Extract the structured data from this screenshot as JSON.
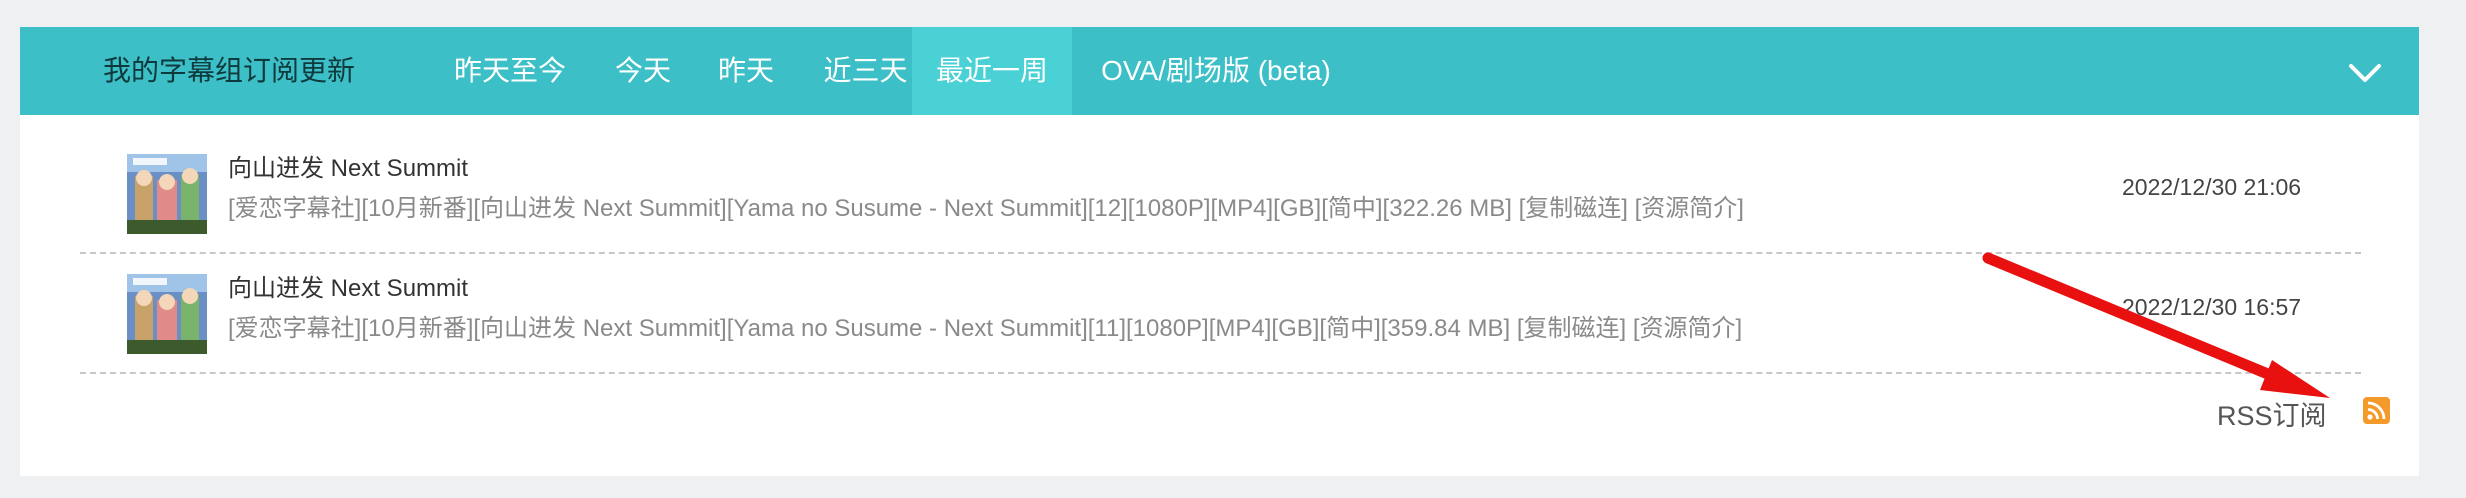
{
  "nav": {
    "title": "我的字幕组订阅更新",
    "tabs": [
      {
        "label": "昨天至今"
      },
      {
        "label": "今天"
      },
      {
        "label": "昨天"
      },
      {
        "label": "近三天"
      },
      {
        "label": "最近一周",
        "active": true
      },
      {
        "label": "OVA/剧场版 (beta)"
      }
    ],
    "expand_icon": "chevron-down-icon"
  },
  "items": [
    {
      "title": "向山进发 Next Summit",
      "release": "[爱恋字幕社][10月新番][向山进发 Next Summit][Yama no Susume - Next Summit][12][1080P][MP4][GB][简中][322.26 MB]",
      "copy_magnet": "[复制磁连]",
      "intro": "[资源简介]",
      "date": "2022/12/30 21:06"
    },
    {
      "title": "向山进发 Next Summit",
      "release": "[爱恋字幕社][10月新番][向山进发 Next Summit][Yama no Susume - Next Summit][11][1080P][MP4][GB][简中][359.84 MB]",
      "copy_magnet": "[复制磁连]",
      "intro": "[资源简介]",
      "date": "2022/12/30 16:57"
    }
  ],
  "rss": {
    "label": "RSS订阅",
    "icon": "rss-icon"
  },
  "colors": {
    "nav": "#3cbfc6",
    "nav_active": "#49d1d6",
    "annotation_arrow": "#e8110f",
    "rss": "#f39a2b"
  }
}
